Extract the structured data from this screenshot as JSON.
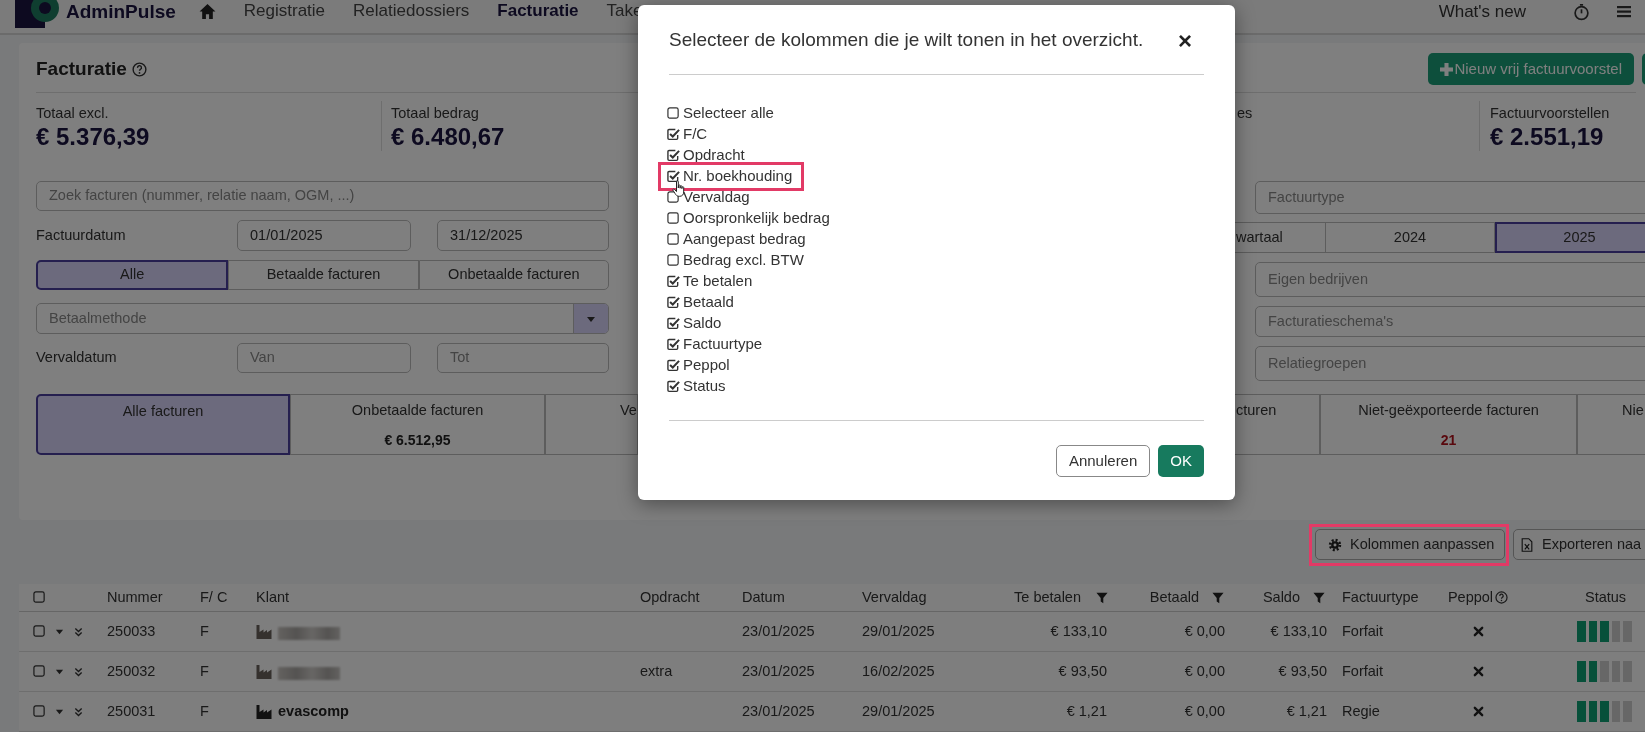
{
  "nav": {
    "app_name": "AdminPulse",
    "items": [
      {
        "label": "Registratie",
        "selected": false
      },
      {
        "label": "Relatiedossiers",
        "selected": false
      },
      {
        "label": "Facturatie",
        "selected": true
      },
      {
        "label": "Take",
        "selected": false
      }
    ],
    "whats_new": "What's new"
  },
  "page": {
    "title": "Facturatie",
    "new_button": "Nieuw vrij factuurvoorstel"
  },
  "stats": [
    {
      "label": "Totaal excl.",
      "value": "€ 5.376,39"
    },
    {
      "label": "Totaal bedrag",
      "value": "€ 6.480,67"
    },
    {
      "label": "es"
    },
    {
      "label": "Factuurvoorstellen",
      "value": "€ 2.551,19"
    }
  ],
  "filters": {
    "search_placeholder": "Zoek facturen (nummer, relatie naam, OGM, ...)",
    "invoice_date_label": "Factuurdatum",
    "date_from": "01/01/2025",
    "date_to": "31/12/2025",
    "payment_tabs": [
      {
        "label": "Alle",
        "selected": true
      },
      {
        "label": "Betaalde facturen",
        "selected": false
      },
      {
        "label": "Onbetaalde facturen",
        "selected": false
      }
    ],
    "payment_method_placeholder": "Betaalmethode",
    "due_date_label": "Vervaldatum",
    "due_from_placeholder": "Van",
    "due_to_placeholder": "Tot",
    "invoice_type_placeholder": "Factuurtype",
    "period_tabs": [
      {
        "label": "wartaal",
        "selected": false
      },
      {
        "label": "2024",
        "selected": false
      },
      {
        "label": "2025",
        "selected": true
      }
    ],
    "own_companies_placeholder": "Eigen bedrijven",
    "schedules_placeholder": "Facturatieschema's",
    "relation_groups_placeholder": "Relatiegroepen"
  },
  "tiles_left": [
    {
      "label": "Alle facturen",
      "selected": true
    },
    {
      "label": "Onbetaalde facturen",
      "value": "€ 6.512,95",
      "alert": false,
      "selected": false
    },
    {
      "label": "Ve",
      "selected": false
    }
  ],
  "tiles_right": [
    {
      "label": "cturen",
      "selected": false
    },
    {
      "label": "Niet-geëxporteerde facturen",
      "value": "21",
      "alert": true,
      "selected": false
    },
    {
      "label": "Nie",
      "selected": false
    }
  ],
  "actions": [
    {
      "label": "Kolommen aanpassen",
      "kind": "gear",
      "highlighted": true
    },
    {
      "label": "Exporteren naa",
      "kind": "excel",
      "highlighted": false
    }
  ],
  "table": {
    "select_all_checked": false,
    "columns": [
      {
        "label": "Nummer",
        "filter": false,
        "help": false
      },
      {
        "label": "F/ C",
        "filter": false,
        "help": false
      },
      {
        "label": "Klant",
        "filter": false,
        "help": false
      },
      {
        "label": "Opdracht",
        "filter": false,
        "help": false
      },
      {
        "label": "Datum",
        "filter": false,
        "help": false
      },
      {
        "label": "Vervaldag",
        "filter": false,
        "help": false
      },
      {
        "label": "Te betalen",
        "filter": true,
        "help": false
      },
      {
        "label": "Betaald",
        "filter": true,
        "help": false
      },
      {
        "label": "Saldo",
        "filter": true,
        "help": false
      },
      {
        "label": "Factuurtype",
        "filter": false,
        "help": false
      },
      {
        "label": "Peppol",
        "filter": false,
        "help": true
      },
      {
        "label": "Status",
        "filter": false,
        "help": false
      }
    ],
    "rows": [
      {
        "checked": false,
        "number": "250033",
        "fc": "F",
        "client": {
          "kind": "redacted"
        },
        "date": "23/01/2025",
        "due": "29/01/2025",
        "to_pay": "€ 133,10",
        "paid": "€ 0,00",
        "balance": "€ 133,10",
        "type": "Forfait",
        "peppol": false,
        "level": 0.6
      },
      {
        "checked": false,
        "number": "250032",
        "fc": "F",
        "client": {
          "kind": "redacted"
        },
        "assignment": "extra",
        "date": "23/01/2025",
        "due": "16/02/2025",
        "to_pay": "€ 93,50",
        "paid": "€ 0,00",
        "balance": "€ 93,50",
        "type": "Forfait",
        "peppol": false,
        "level": 0.4
      },
      {
        "checked": false,
        "number": "250031",
        "fc": "F",
        "client": {
          "kind": "company",
          "name": "evascomp"
        },
        "date": "23/01/2025",
        "due": "29/01/2025",
        "to_pay": "€ 1,21",
        "paid": "€ 0,00",
        "balance": "€ 1,21",
        "type": "Regie",
        "peppol": false,
        "level": 0.6
      }
    ]
  },
  "modal": {
    "title": "Selecteer de kolommen die je wilt tonen in het overzicht.",
    "close": "×",
    "cancel": "Annuleren",
    "ok": "OK",
    "options": [
      {
        "label": "Selecteer alle",
        "checked": false,
        "highlighted": false
      },
      {
        "label": "F/C",
        "checked": true,
        "highlighted": false
      },
      {
        "label": "Opdracht",
        "checked": true,
        "highlighted": false
      },
      {
        "label": "Nr. boekhouding",
        "checked": true,
        "highlighted": true
      },
      {
        "label": "Vervaldag",
        "checked": false,
        "highlighted": false
      },
      {
        "label": "Oorspronkelijk bedrag",
        "checked": false,
        "highlighted": false
      },
      {
        "label": "Aangepast bedrag",
        "checked": false,
        "highlighted": false
      },
      {
        "label": "Bedrag excl. BTW",
        "checked": false,
        "highlighted": false
      },
      {
        "label": "Te betalen",
        "checked": true,
        "highlighted": false
      },
      {
        "label": "Betaald",
        "checked": true,
        "highlighted": false
      },
      {
        "label": "Saldo",
        "checked": true,
        "highlighted": false
      },
      {
        "label": "Factuurtype",
        "checked": true,
        "highlighted": false
      },
      {
        "label": "Peppol",
        "checked": true,
        "highlighted": false
      },
      {
        "label": "Status",
        "checked": true,
        "highlighted": false
      }
    ]
  }
}
